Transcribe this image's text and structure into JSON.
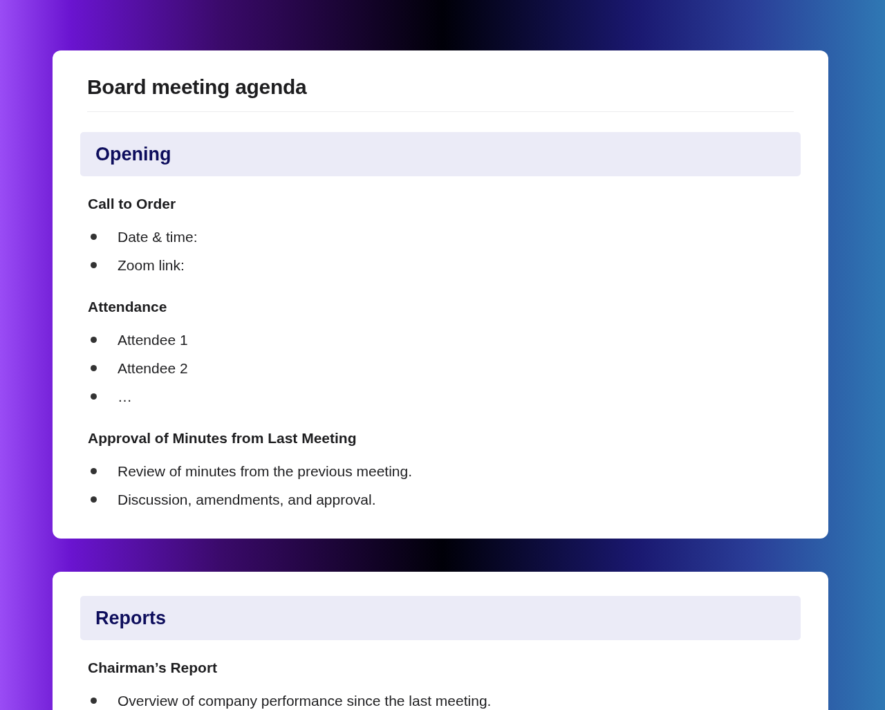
{
  "cards": [
    {
      "title": "Board meeting agenda",
      "sections": [
        {
          "heading": "Opening",
          "subsections": [
            {
              "heading": "Call to Order",
              "items": [
                "Date & time:",
                "Zoom link:"
              ]
            },
            {
              "heading": "Attendance",
              "items": [
                "Attendee 1",
                "Attendee 2",
                "…"
              ]
            },
            {
              "heading": "Approval of Minutes from Last Meeting",
              "items": [
                "Review of minutes from the previous meeting.",
                "Discussion, amendments, and approval."
              ]
            }
          ]
        }
      ]
    },
    {
      "sections": [
        {
          "heading": "Reports",
          "subsections": [
            {
              "heading": "Chairman’s Report",
              "items": [
                "Overview of company performance since the last meeting."
              ]
            }
          ]
        }
      ]
    }
  ]
}
